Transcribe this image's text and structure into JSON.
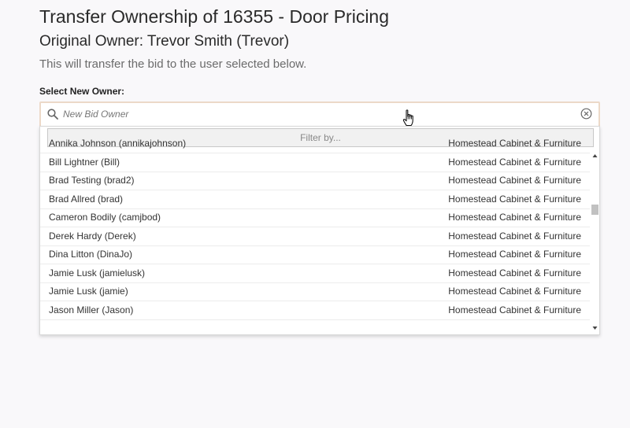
{
  "page": {
    "title": "Transfer Ownership of 16355 - Door Pricing",
    "subtitle": "Original Owner: Trevor Smith (Trevor)",
    "note": "This will transfer the bid to the user selected below."
  },
  "owner_select": {
    "label": "Select New Owner:",
    "placeholder": "New Bid Owner",
    "value": "",
    "filter_placeholder": "Filter by..."
  },
  "users": [
    {
      "name": "Annika Johnson (annikajohnson)",
      "company": "Homestead Cabinet & Furniture"
    },
    {
      "name": "Bill Lightner (Bill)",
      "company": "Homestead Cabinet & Furniture"
    },
    {
      "name": "Brad Testing (brad2)",
      "company": "Homestead Cabinet & Furniture"
    },
    {
      "name": "Brad Allred (brad)",
      "company": "Homestead Cabinet & Furniture"
    },
    {
      "name": "Cameron Bodily (camjbod)",
      "company": "Homestead Cabinet & Furniture"
    },
    {
      "name": "Derek Hardy (Derek)",
      "company": "Homestead Cabinet & Furniture"
    },
    {
      "name": "Dina Litton (DinaJo)",
      "company": "Homestead Cabinet & Furniture"
    },
    {
      "name": "Jamie Lusk (jamielusk)",
      "company": "Homestead Cabinet & Furniture"
    },
    {
      "name": "Jamie Lusk (jamie)",
      "company": "Homestead Cabinet & Furniture"
    },
    {
      "name": "Jason Miller (Jason)",
      "company": "Homestead Cabinet & Furniture"
    }
  ],
  "icons": {
    "search": "search-icon",
    "clear": "clear-circle-x-icon",
    "cursor": "hand-pointer-cursor-icon"
  },
  "colors": {
    "focus_border": "#ecd9c8",
    "background": "#f9f8fa"
  }
}
